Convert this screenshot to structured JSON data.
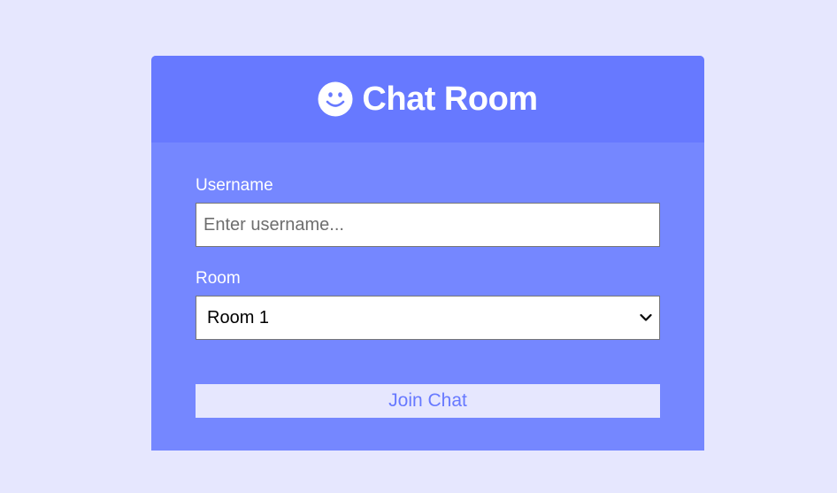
{
  "header": {
    "title": "Chat Room",
    "icon": "smile-icon"
  },
  "form": {
    "username_label": "Username",
    "username_placeholder": "Enter username...",
    "username_value": "",
    "room_label": "Room",
    "room_selected": "Room 1",
    "join_label": "Join Chat"
  },
  "colors": {
    "page_bg": "#e6e7fe",
    "header_bg": "#6779ff",
    "card_bg": "#7587ff",
    "button_bg": "#e6e7fe",
    "button_text": "#6779ff"
  }
}
